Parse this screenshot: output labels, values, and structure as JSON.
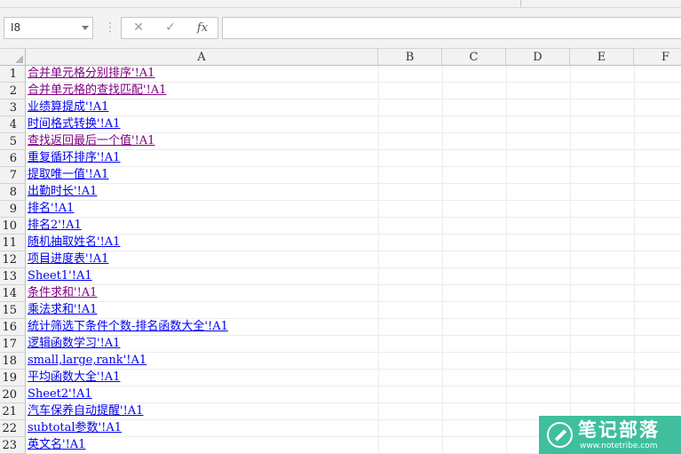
{
  "formula_bar": {
    "name_box": "I8",
    "cancel_glyph": "✕",
    "enter_glyph": "✓",
    "function_glyph": "fx",
    "formula_value": ""
  },
  "columns": [
    "A",
    "B",
    "C",
    "D",
    "E",
    "F"
  ],
  "rows": [
    {
      "num": "1",
      "text": "合并单元格分别排序'!A1",
      "visited": true
    },
    {
      "num": "2",
      "text": "合并单元格的查找匹配'!A1",
      "visited": true
    },
    {
      "num": "3",
      "text": "业绩算提成'!A1",
      "visited": false
    },
    {
      "num": "4",
      "text": "时间格式转换'!A1",
      "visited": false
    },
    {
      "num": "5",
      "text": "查找返回最后一个值'!A1",
      "visited": true
    },
    {
      "num": "6",
      "text": "重复循环排序'!A1",
      "visited": false
    },
    {
      "num": "7",
      "text": "提取唯一值'!A1",
      "visited": false
    },
    {
      "num": "8",
      "text": "出勤时长'!A1",
      "visited": false
    },
    {
      "num": "9",
      "text": "排名'!A1",
      "visited": false
    },
    {
      "num": "10",
      "text": "排名2'!A1",
      "visited": false
    },
    {
      "num": "11",
      "text": "随机抽取姓名'!A1",
      "visited": false
    },
    {
      "num": "12",
      "text": "项目进度表'!A1",
      "visited": false
    },
    {
      "num": "13",
      "text": "Sheet1'!A1",
      "visited": false
    },
    {
      "num": "14",
      "text": "条件求和'!A1",
      "visited": true
    },
    {
      "num": "15",
      "text": "乘法求和'!A1",
      "visited": false
    },
    {
      "num": "16",
      "text": "统计筛选下条件个数-排名函数大全'!A1",
      "visited": false
    },
    {
      "num": "17",
      "text": "逻辑函数学习'!A1",
      "visited": false
    },
    {
      "num": "18",
      "text": "small,large,rank'!A1",
      "visited": false
    },
    {
      "num": "19",
      "text": "平均函数大全'!A1",
      "visited": false
    },
    {
      "num": "20",
      "text": "Sheet2'!A1",
      "visited": false
    },
    {
      "num": "21",
      "text": "汽车保养自动提醒'!A1",
      "visited": false
    },
    {
      "num": "22",
      "text": "subtotal参数'!A1",
      "visited": false
    },
    {
      "num": "23",
      "text": "英文名'!A1",
      "visited": false
    }
  ],
  "colors": {
    "link": "#0000ee",
    "visited_link": "#800080"
  },
  "watermark": {
    "title": "笔记部落",
    "url": "www.notetribe.com",
    "icon": "pen-icon"
  }
}
